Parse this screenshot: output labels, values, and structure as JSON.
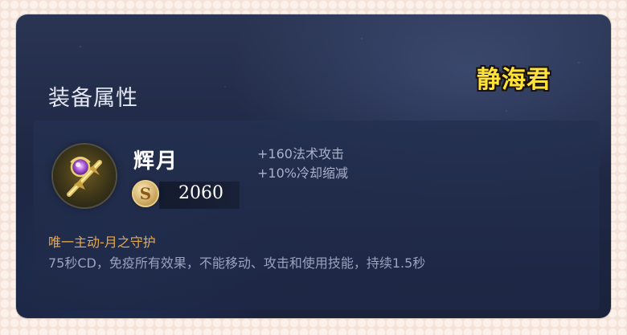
{
  "panel": {
    "section_title": "装备属性"
  },
  "watermark": {
    "text": "静海君",
    "color": "#ffe23a"
  },
  "item": {
    "name": "辉月",
    "icon": "scepter-icon",
    "price": "2060",
    "currency_icon": "gold-coin-icon",
    "stats": [
      "+160法术攻击",
      "+10%冷却缩减"
    ]
  },
  "skill": {
    "title": "唯一主动-月之守护",
    "description": "75秒CD，免疫所有效果，不能移动、攻击和使用技能，持续1.5秒",
    "title_color": "#e8a94b"
  }
}
